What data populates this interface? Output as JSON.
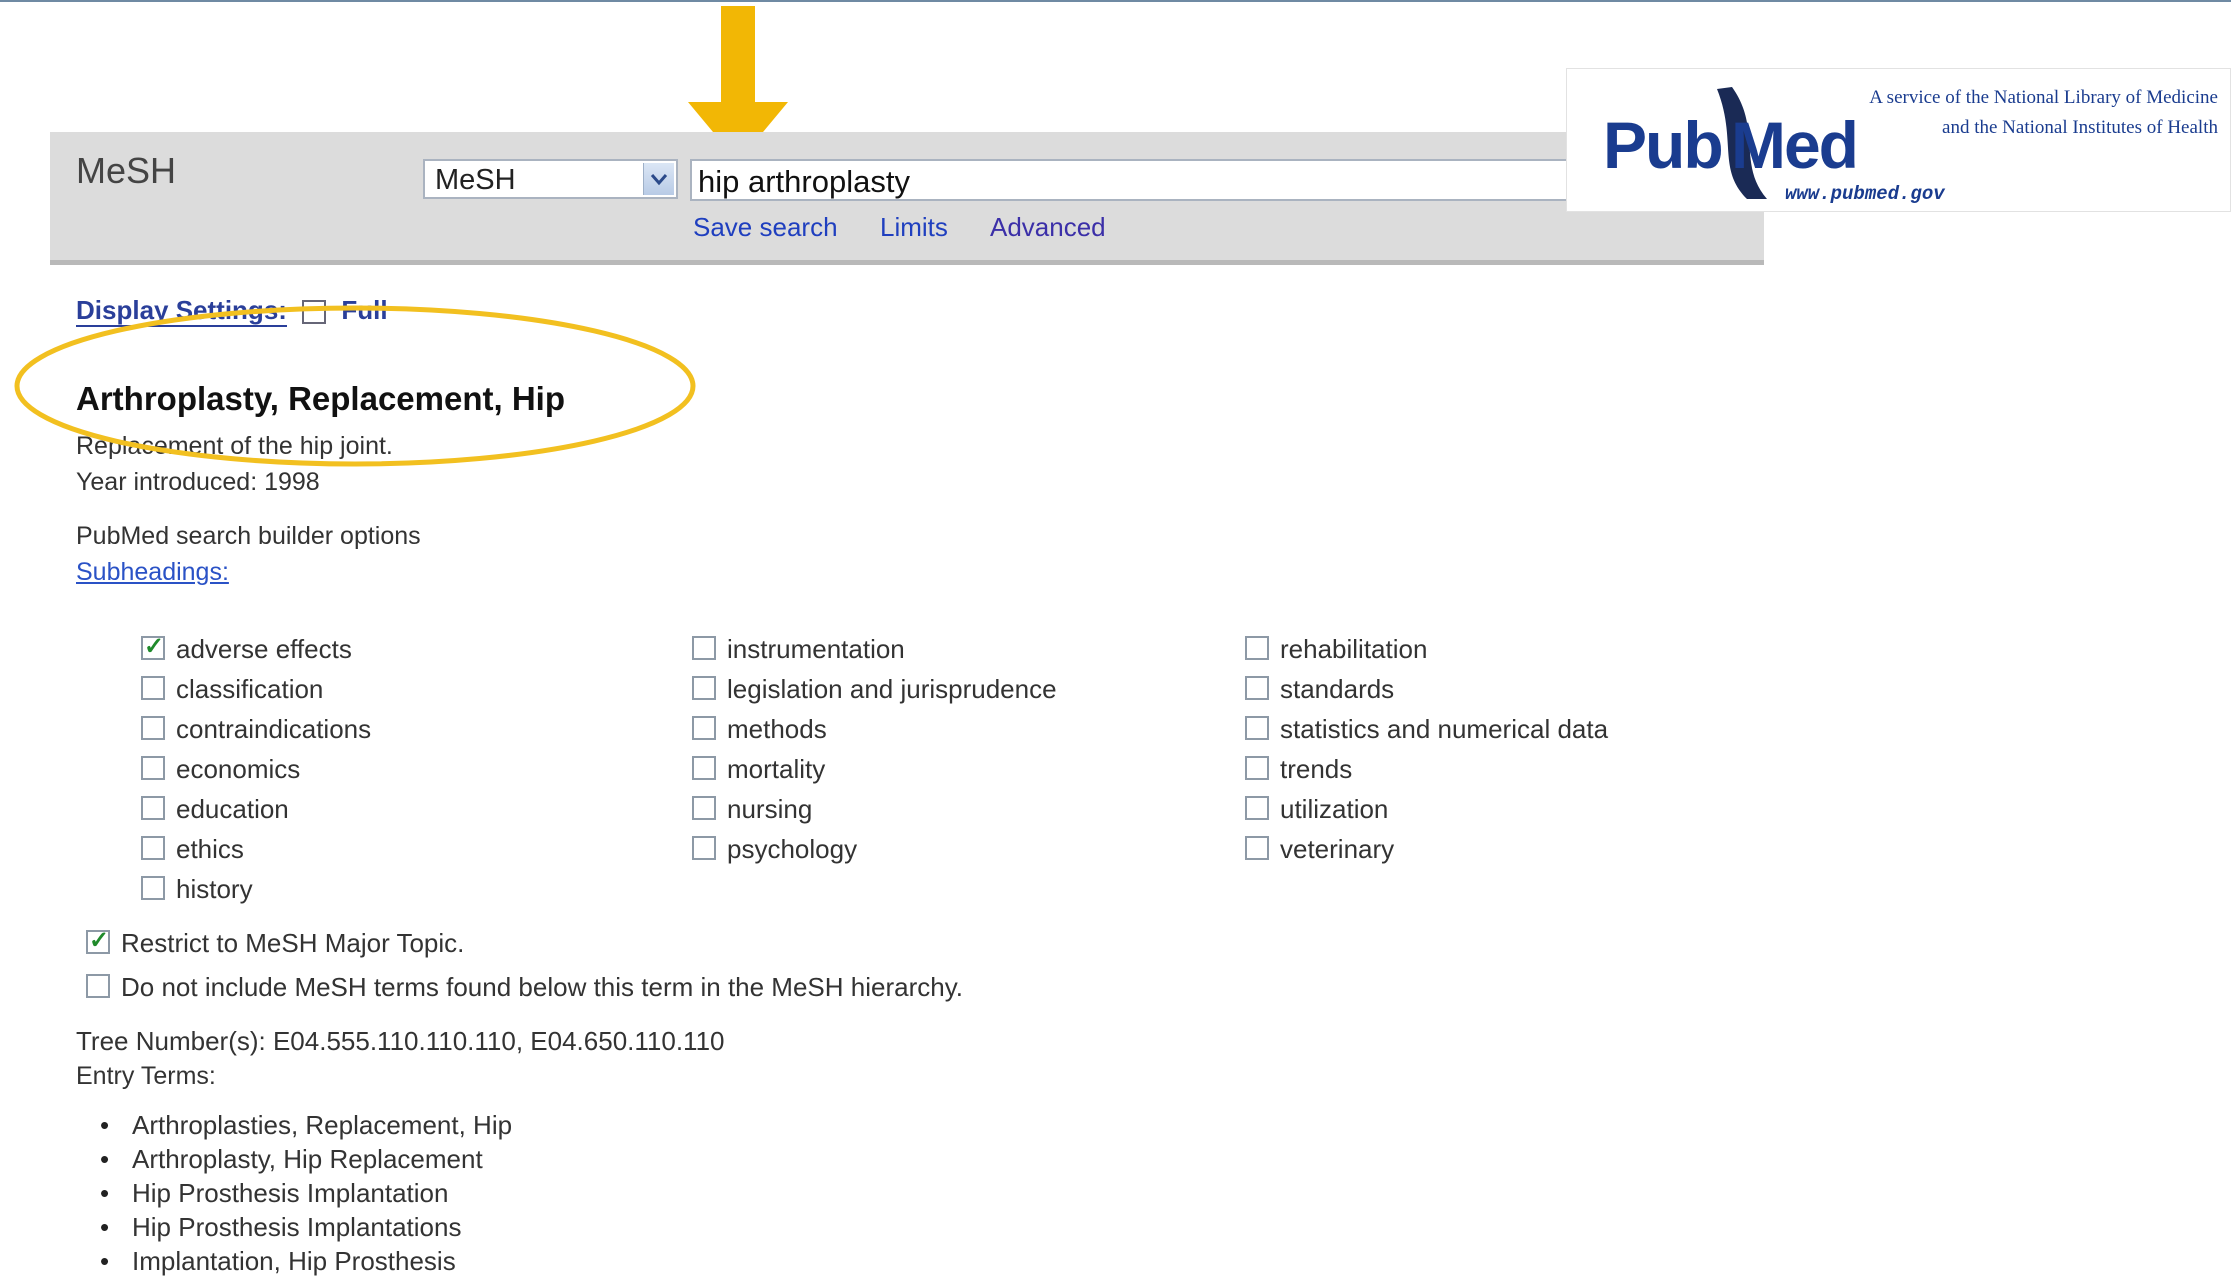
{
  "search_bar": {
    "db_label": "MeSH",
    "db_select_value": "MeSH",
    "query": "hip arthroplasty",
    "links": [
      "Save search",
      "Limits",
      "Advanced"
    ]
  },
  "logo": {
    "name_left": "Pub",
    "name_right": "Med",
    "url": "www.pubmed.gov",
    "tagline_1": "A service of the National Library of Medicine",
    "tagline_2": "and the National Institutes of Health"
  },
  "display_settings": {
    "label": "Display Settings:",
    "value": "Full"
  },
  "term": {
    "title": "Arthroplasty, Replacement, Hip",
    "scope_note": "Replacement of the hip joint.",
    "year_introduced": "Year introduced: 1998",
    "builder_heading": "PubMed search builder options",
    "subheadings_link": "Subheadings:"
  },
  "subheadings": {
    "col1": [
      {
        "label": "adverse effects",
        "checked": true
      },
      {
        "label": "classification",
        "checked": false
      },
      {
        "label": "contraindications",
        "checked": false
      },
      {
        "label": "economics",
        "checked": false
      },
      {
        "label": "education",
        "checked": false
      },
      {
        "label": "ethics",
        "checked": false
      },
      {
        "label": "history",
        "checked": false
      }
    ],
    "col2": [
      {
        "label": "instrumentation",
        "checked": false
      },
      {
        "label": "legislation and jurisprudence",
        "checked": false
      },
      {
        "label": "methods",
        "checked": false
      },
      {
        "label": "mortality",
        "checked": false
      },
      {
        "label": "nursing",
        "checked": false
      },
      {
        "label": "psychology",
        "checked": false
      }
    ],
    "col3": [
      {
        "label": "rehabilitation",
        "checked": false
      },
      {
        "label": "standards",
        "checked": false
      },
      {
        "label": "statistics and numerical data",
        "checked": false
      },
      {
        "label": "trends",
        "checked": false
      },
      {
        "label": "utilization",
        "checked": false
      },
      {
        "label": "veterinary",
        "checked": false
      }
    ]
  },
  "options": {
    "restrict_major": {
      "label": "Restrict to MeSH Major Topic.",
      "checked": true
    },
    "no_explode": {
      "label": "Do not include MeSH terms found below this term in the MeSH hierarchy.",
      "checked": false
    }
  },
  "tree": {
    "numbers": "Tree Number(s): E04.555.110.110.110, E04.650.110.110",
    "entry_terms_heading": "Entry Terms:",
    "entry_terms": [
      "Arthroplasties, Replacement, Hip",
      "Arthroplasty, Hip Replacement",
      "Hip Prosthesis Implantation",
      "Hip Prosthesis Implantations",
      "Implantation, Hip Prosthesis"
    ]
  },
  "colors": {
    "arrow": "#f2b705",
    "highlight_ellipse": "#f2c020",
    "link": "#1f3fbf",
    "logo_blue": "#1a3c8f"
  }
}
